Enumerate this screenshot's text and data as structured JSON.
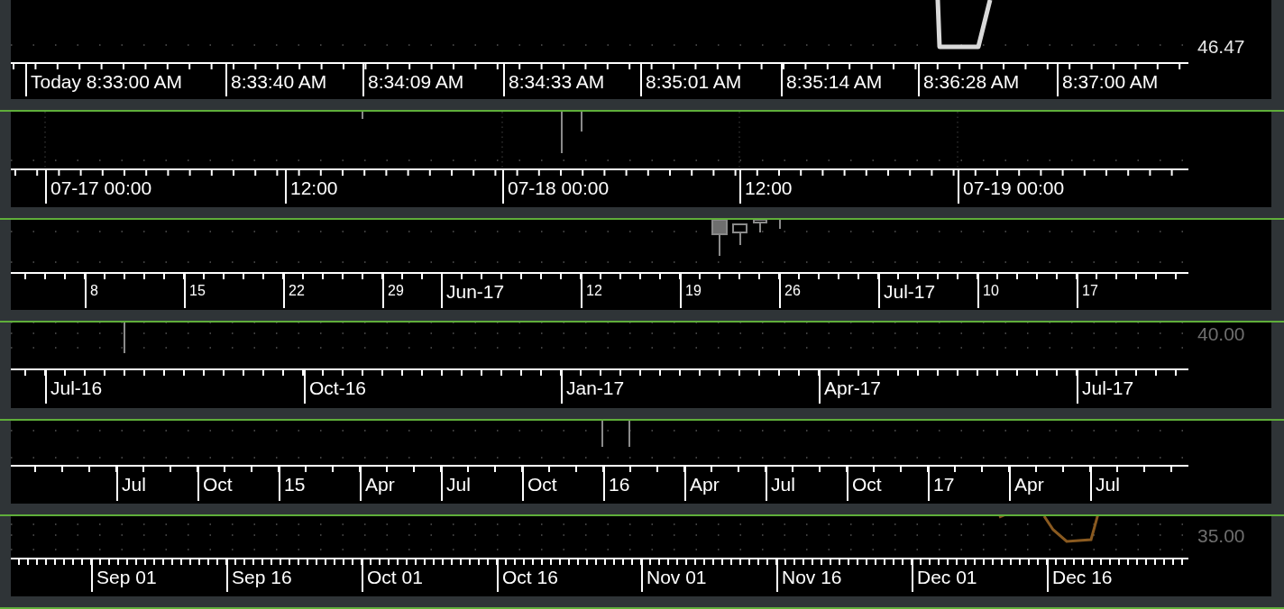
{
  "panels": [
    {
      "axis_labels": [
        "Today 8:33:00 AM",
        "8:33:40 AM",
        "8:34:09 AM",
        "8:34:33 AM",
        "8:35:01 AM",
        "8:35:14 AM",
        "8:36:28 AM",
        "8:37:00 AM"
      ],
      "price_label": {
        "text": "46.47",
        "highlighted": true
      }
    },
    {
      "axis_labels": [
        "07-17 00:00",
        "12:00",
        "07-18 00:00",
        "12:00",
        "07-19 00:00"
      ]
    },
    {
      "axis_labels": [
        {
          "text": "8",
          "major": false
        },
        {
          "text": "15",
          "major": false
        },
        {
          "text": "22",
          "major": false
        },
        {
          "text": "29",
          "major": false
        },
        {
          "text": "Jun-17",
          "major": true
        },
        {
          "text": "12",
          "major": false
        },
        {
          "text": "19",
          "major": false
        },
        {
          "text": "26",
          "major": false
        },
        {
          "text": "Jul-17",
          "major": true
        },
        {
          "text": "10",
          "major": false
        },
        {
          "text": "17",
          "major": false
        }
      ]
    },
    {
      "axis_labels": [
        "Jul-16",
        "Oct-16",
        "Jan-17",
        "Apr-17",
        "Jul-17"
      ],
      "price_label": {
        "text": "40.00",
        "highlighted": false
      }
    },
    {
      "axis_labels": [
        "Jul",
        "Oct",
        "15",
        "Apr",
        "Jul",
        "Oct",
        "16",
        "Apr",
        "Jul",
        "Oct",
        "17",
        "Apr",
        "Jul"
      ]
    },
    {
      "axis_labels": [
        "Sep 01",
        "Sep 16",
        "Oct 01",
        "Oct 16",
        "Nov 01",
        "Nov 16",
        "Dec 01",
        "Dec 16"
      ],
      "price_label": {
        "text": "35.00",
        "highlighted": false
      }
    }
  ]
}
